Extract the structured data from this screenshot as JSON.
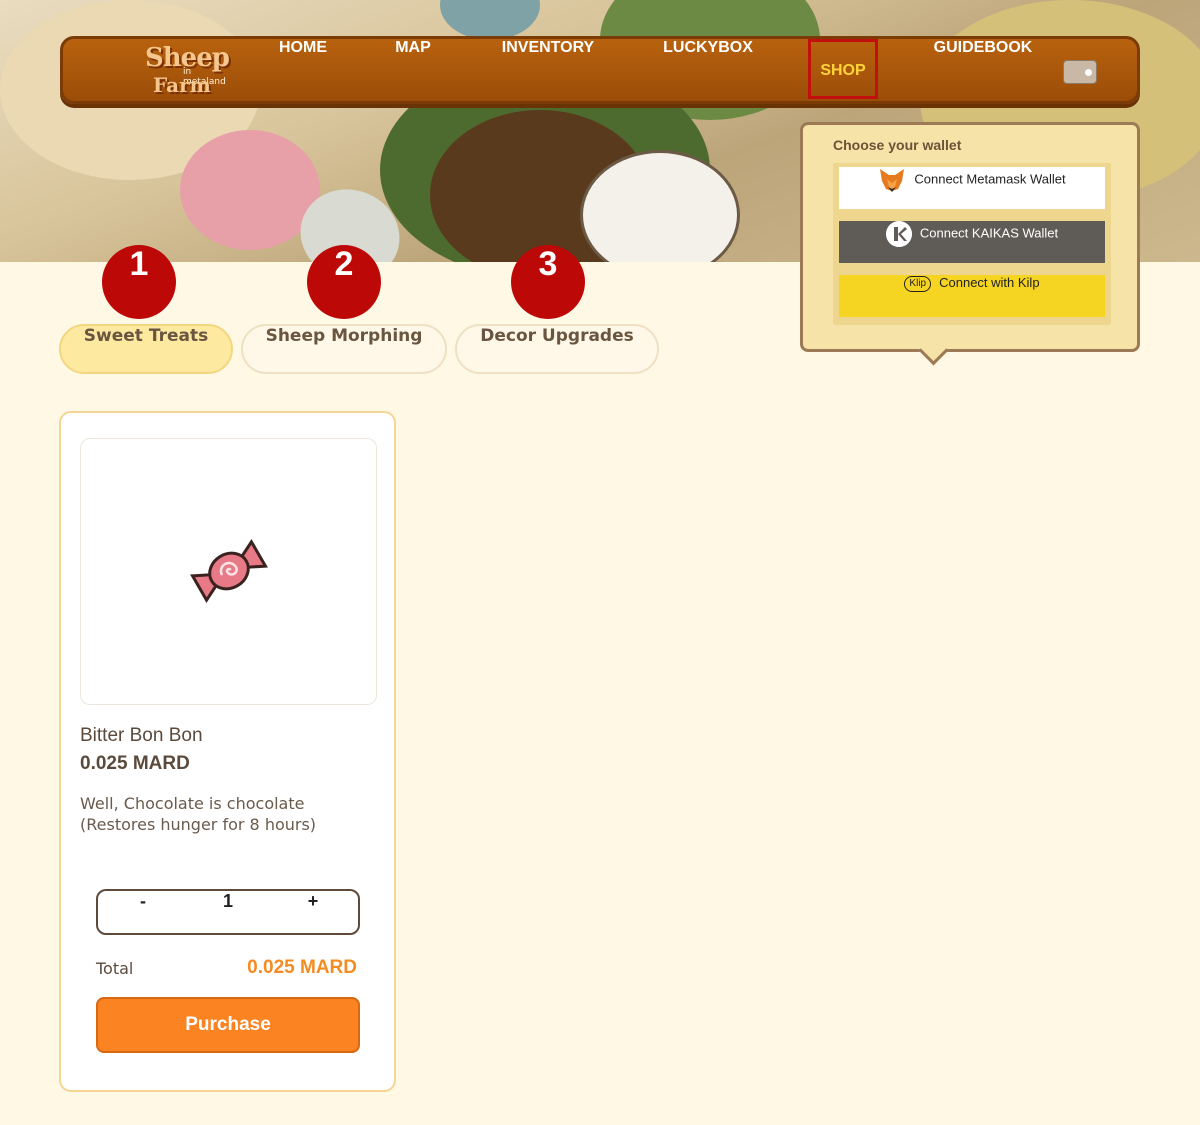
{
  "nav": {
    "logo": {
      "line1": "Sheep",
      "line2": "in metaland",
      "line3": "Farm"
    },
    "items": [
      {
        "label": "HOME"
      },
      {
        "label": "MAP"
      },
      {
        "label": "INVENTORY"
      },
      {
        "label": "LUCKYBOX"
      },
      {
        "label": "SHOP"
      },
      {
        "label": "GUIDEBOOK"
      }
    ],
    "active": "SHOP",
    "active_color": "#ffd43a"
  },
  "wallet_popup": {
    "title": "Choose your wallet",
    "options": [
      {
        "label": "Connect Metamask Wallet",
        "icon": "metamask-fox-icon"
      },
      {
        "label": "Connect KAIKAS Wallet",
        "icon": "kaikas-icon"
      },
      {
        "label": "Connect with Kilp",
        "icon": "kilp-icon",
        "icon_text": "Klip"
      }
    ]
  },
  "markers": [
    "1",
    "2",
    "3"
  ],
  "tabs": [
    {
      "label": "Sweet Treats",
      "selected": true
    },
    {
      "label": "Sheep Morphing",
      "selected": false
    },
    {
      "label": "Decor Upgrades",
      "selected": false
    }
  ],
  "product": {
    "name": "Bitter Bon Bon",
    "price": "0.025 MARD",
    "description_line1": "Well, Chocolate is chocolate",
    "description_line2": "(Restores hunger for 8 hours)",
    "quantity": "1",
    "minus": "-",
    "plus": "+",
    "total_label": "Total",
    "total_value": "0.025 MARD",
    "purchase_label": "Purchase",
    "image_icon": "candy-icon"
  },
  "colors": {
    "accent": "#fc8322",
    "marker": "#bd0808",
    "navbar": "#b8620e",
    "background": "#fff8e4"
  }
}
